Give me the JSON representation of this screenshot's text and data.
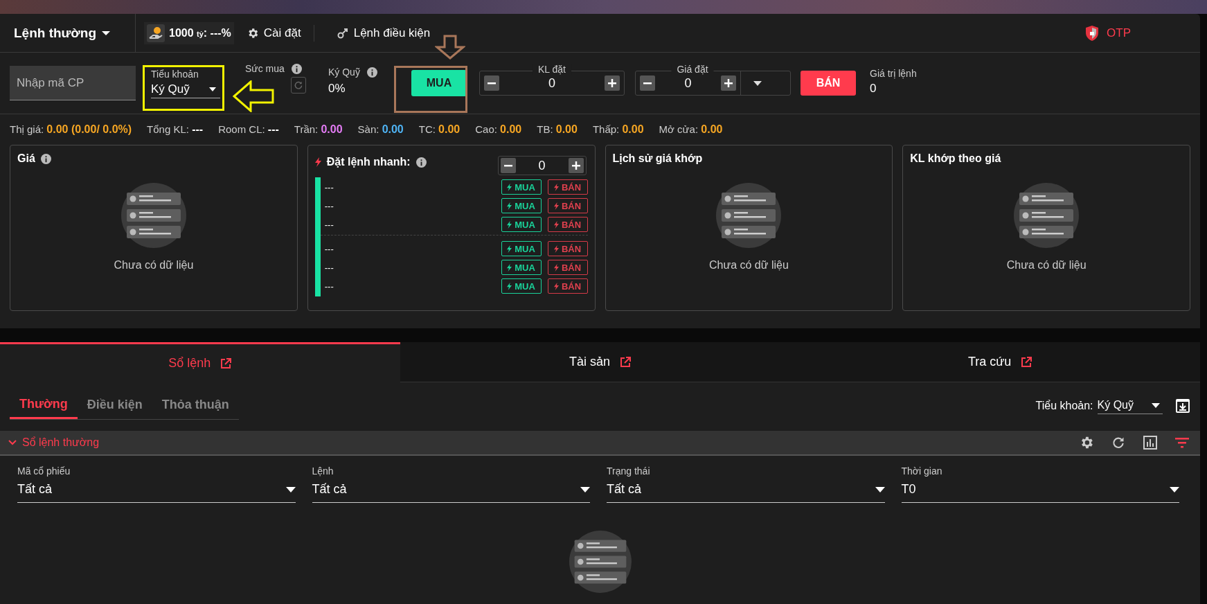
{
  "top_bar": {
    "order_type": "Lệnh thường",
    "balance": {
      "amount": "1000",
      "unit": "tỷ",
      "rest": ": ---%"
    },
    "settings": "Cài đặt",
    "conditional": "Lệnh điều kiện",
    "otp": "OTP"
  },
  "order_form": {
    "symbol_placeholder": "Nhập mã CP",
    "sub_account": {
      "label": "Tiểu khoản",
      "value": "Ký Quỹ"
    },
    "buying_power": {
      "label": "Sức mua"
    },
    "margin": {
      "label": "Ký Quỹ",
      "value": "0%"
    },
    "buy": "MUA",
    "quantity": {
      "label": "KL đặt",
      "value": "0"
    },
    "price": {
      "label": "Giá đặt",
      "value": "0"
    },
    "sell": "BÁN",
    "order_value": {
      "label": "Giá trị lệnh",
      "value": "0"
    }
  },
  "stats": [
    {
      "label": "Thị giá:",
      "value": "0.00 (0.00/ 0.0%)",
      "color": "#f6a623"
    },
    {
      "label": "Tổng KL:",
      "value": "---",
      "color": "#ffffff"
    },
    {
      "label": "Room CL:",
      "value": "---",
      "color": "#ffffff"
    },
    {
      "label": "Trần:",
      "value": "0.00",
      "color": "#e47cf5"
    },
    {
      "label": "Sàn:",
      "value": "0.00",
      "color": "#4fb4f5"
    },
    {
      "label": "TC:",
      "value": "0.00",
      "color": "#f6a623"
    },
    {
      "label": "Cao:",
      "value": "0.00",
      "color": "#f6a623"
    },
    {
      "label": "TB:",
      "value": "0.00",
      "color": "#f6a623"
    },
    {
      "label": "Thấp:",
      "value": "0.00",
      "color": "#f6a623"
    },
    {
      "label": "Mở cửa:",
      "value": "0.00",
      "color": "#f6a623"
    }
  ],
  "panels": [
    {
      "kind": "empty",
      "title": "Giá",
      "info": true,
      "empty_text": "Chưa có dữ liệu"
    },
    {
      "kind": "quick",
      "title": "Đặt lệnh nhanh:",
      "info": true,
      "quantity": "0",
      "groups": [
        [
          {
            "price": "---",
            "buy": "MUA",
            "sell": "BÁN"
          },
          {
            "price": "---",
            "buy": "MUA",
            "sell": "BÁN"
          },
          {
            "price": "---",
            "buy": "MUA",
            "sell": "BÁN"
          }
        ],
        [
          {
            "price": "---",
            "buy": "MUA",
            "sell": "BÁN"
          },
          {
            "price": "---",
            "buy": "MUA",
            "sell": "BÁN"
          },
          {
            "price": "---",
            "buy": "MUA",
            "sell": "BÁN"
          }
        ]
      ]
    },
    {
      "kind": "empty",
      "title": "Lịch sử giá khớp",
      "info": false,
      "empty_text": "Chưa có dữ liệu"
    },
    {
      "kind": "empty",
      "title": "KL khớp theo giá",
      "info": false,
      "empty_text": "Chưa có dữ liệu"
    }
  ],
  "bottom_tabs": [
    {
      "label": "Sổ lệnh",
      "selected": true
    },
    {
      "label": "Tài sản",
      "selected": false
    },
    {
      "label": "Tra cứu",
      "selected": false
    }
  ],
  "sub_tabs": [
    {
      "label": "Thường",
      "selected": true
    },
    {
      "label": "Điều kiện",
      "selected": false
    },
    {
      "label": "Thỏa thuận",
      "selected": false
    }
  ],
  "sub_account_filter": {
    "label": "Tiểu khoản:",
    "value": "Ký Quỹ"
  },
  "section": {
    "title": "Sổ lệnh thường",
    "expanded": true
  },
  "filters": [
    {
      "label": "Mã cổ phiếu",
      "value": "Tất cả"
    },
    {
      "label": "Lệnh",
      "value": "Tất cả"
    },
    {
      "label": "Trạng thái",
      "value": "Tất cả"
    },
    {
      "label": "Thời gian",
      "value": "T0"
    }
  ]
}
